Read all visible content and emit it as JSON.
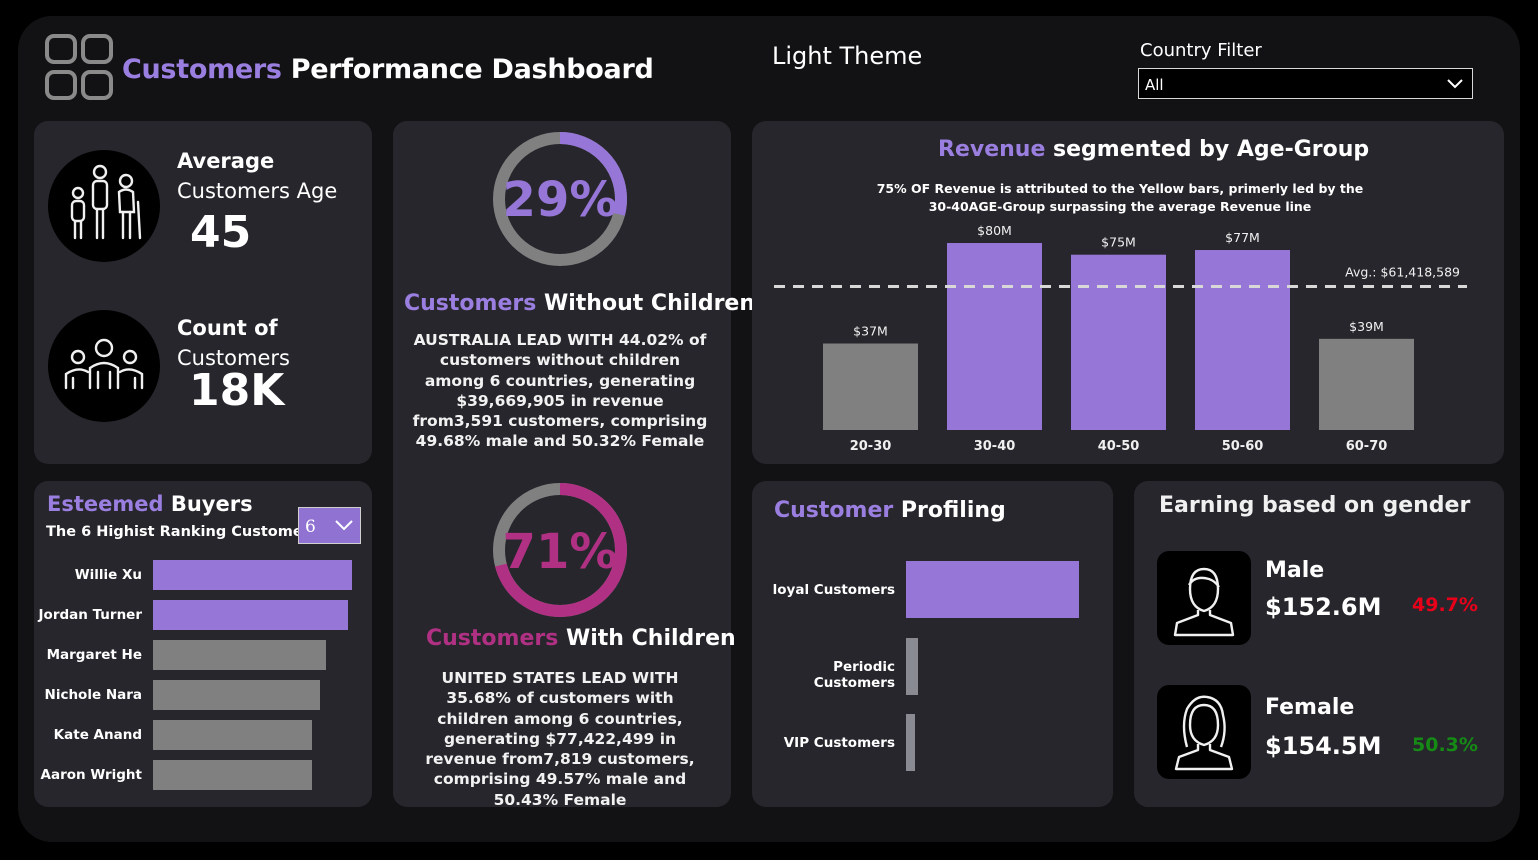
{
  "header": {
    "title_accent": "Customers",
    "title_rest": " Performance Dashboard",
    "theme_label": "Light Theme",
    "filter_label": "Country Filter",
    "filter_value": "All"
  },
  "kpis": {
    "avg_age_line1": "Average",
    "avg_age_line2": "Customers Age",
    "avg_age_value": "45",
    "count_line1": "Count of",
    "count_line2": "Customers",
    "count_value": "18K"
  },
  "without_children": {
    "percent": "29%",
    "fraction": 0.29,
    "title_accent": "Customers",
    "title_rest": " Without Children",
    "text": "AUSTRALIA LEAD WITH 44.02% of customers without children among 6 countries, generating  $39,669,905 in revenue from3,591 customers, comprising 49.68% male and 50.32% Female"
  },
  "with_children": {
    "percent": "71%",
    "fraction": 0.71,
    "title_accent": "Customers",
    "title_rest": " With Children",
    "text": "UNITED STATES LEAD WITH 35.68% of customers with children among 6 countries, generating  $77,422,499 in revenue from7,819 customers, comprising 49.57% male and 50.43% Female"
  },
  "buyers": {
    "title_accent": "Esteemed",
    "title_rest": " Buyers",
    "subtitle": "The 6 Highist Ranking Customers",
    "dropdown_value": "6",
    "chart_data": {
      "type": "bar",
      "orientation": "horizontal",
      "categories": [
        "Willie Xu",
        "Jordan Turner",
        "Margaret He",
        "Nichole Nara",
        "Kate Anand",
        "Aaron Wright"
      ],
      "values": [
        100,
        98,
        87,
        84,
        80,
        80
      ],
      "highlighted": [
        true,
        true,
        false,
        false,
        false,
        false
      ]
    }
  },
  "revenue": {
    "title_accent": "Revenue",
    "title_rest": " segmented by Age-Group",
    "note_line1": "75% OF Revenue is attributed to the Yellow bars, primerly led by the",
    "note_line2": "30-40AGE-Group surpassing the average Revenue line",
    "avg_label": "Avg.: $61,418,589",
    "chart_data": {
      "type": "bar",
      "categories": [
        "20-30",
        "30-40",
        "40-50",
        "50-60",
        "60-70"
      ],
      "values": [
        37,
        80,
        75,
        77,
        39
      ],
      "labels": [
        "$37M",
        "$80M",
        "$75M",
        "$77M",
        "$39M"
      ],
      "highlighted": [
        false,
        true,
        true,
        true,
        false
      ],
      "average": 61.418589,
      "unit": "$M",
      "ylim": [
        0,
        85
      ]
    }
  },
  "profiling": {
    "title_accent": "Customer",
    "title_rest": " Profiling",
    "chart_data": {
      "type": "bar",
      "orientation": "horizontal",
      "categories": [
        "loyal Customers",
        "Periodic Customers",
        "VIP Customers"
      ],
      "values": [
        100,
        7,
        5
      ],
      "highlighted": [
        true,
        false,
        false
      ]
    }
  },
  "gender": {
    "title": "Earning based on gender",
    "male_label": "Male",
    "male_value": "$152.6M",
    "male_pct": "49.7%",
    "female_label": "Female",
    "female_value": "$154.5M",
    "female_pct": "50.3%"
  },
  "colors": {
    "accent": "#9b7fe0",
    "bar_highlight": "#9676d6",
    "bar_neutral": "#808080",
    "magenta": "#b03183",
    "red": "#e8001a",
    "green": "#158a15"
  }
}
